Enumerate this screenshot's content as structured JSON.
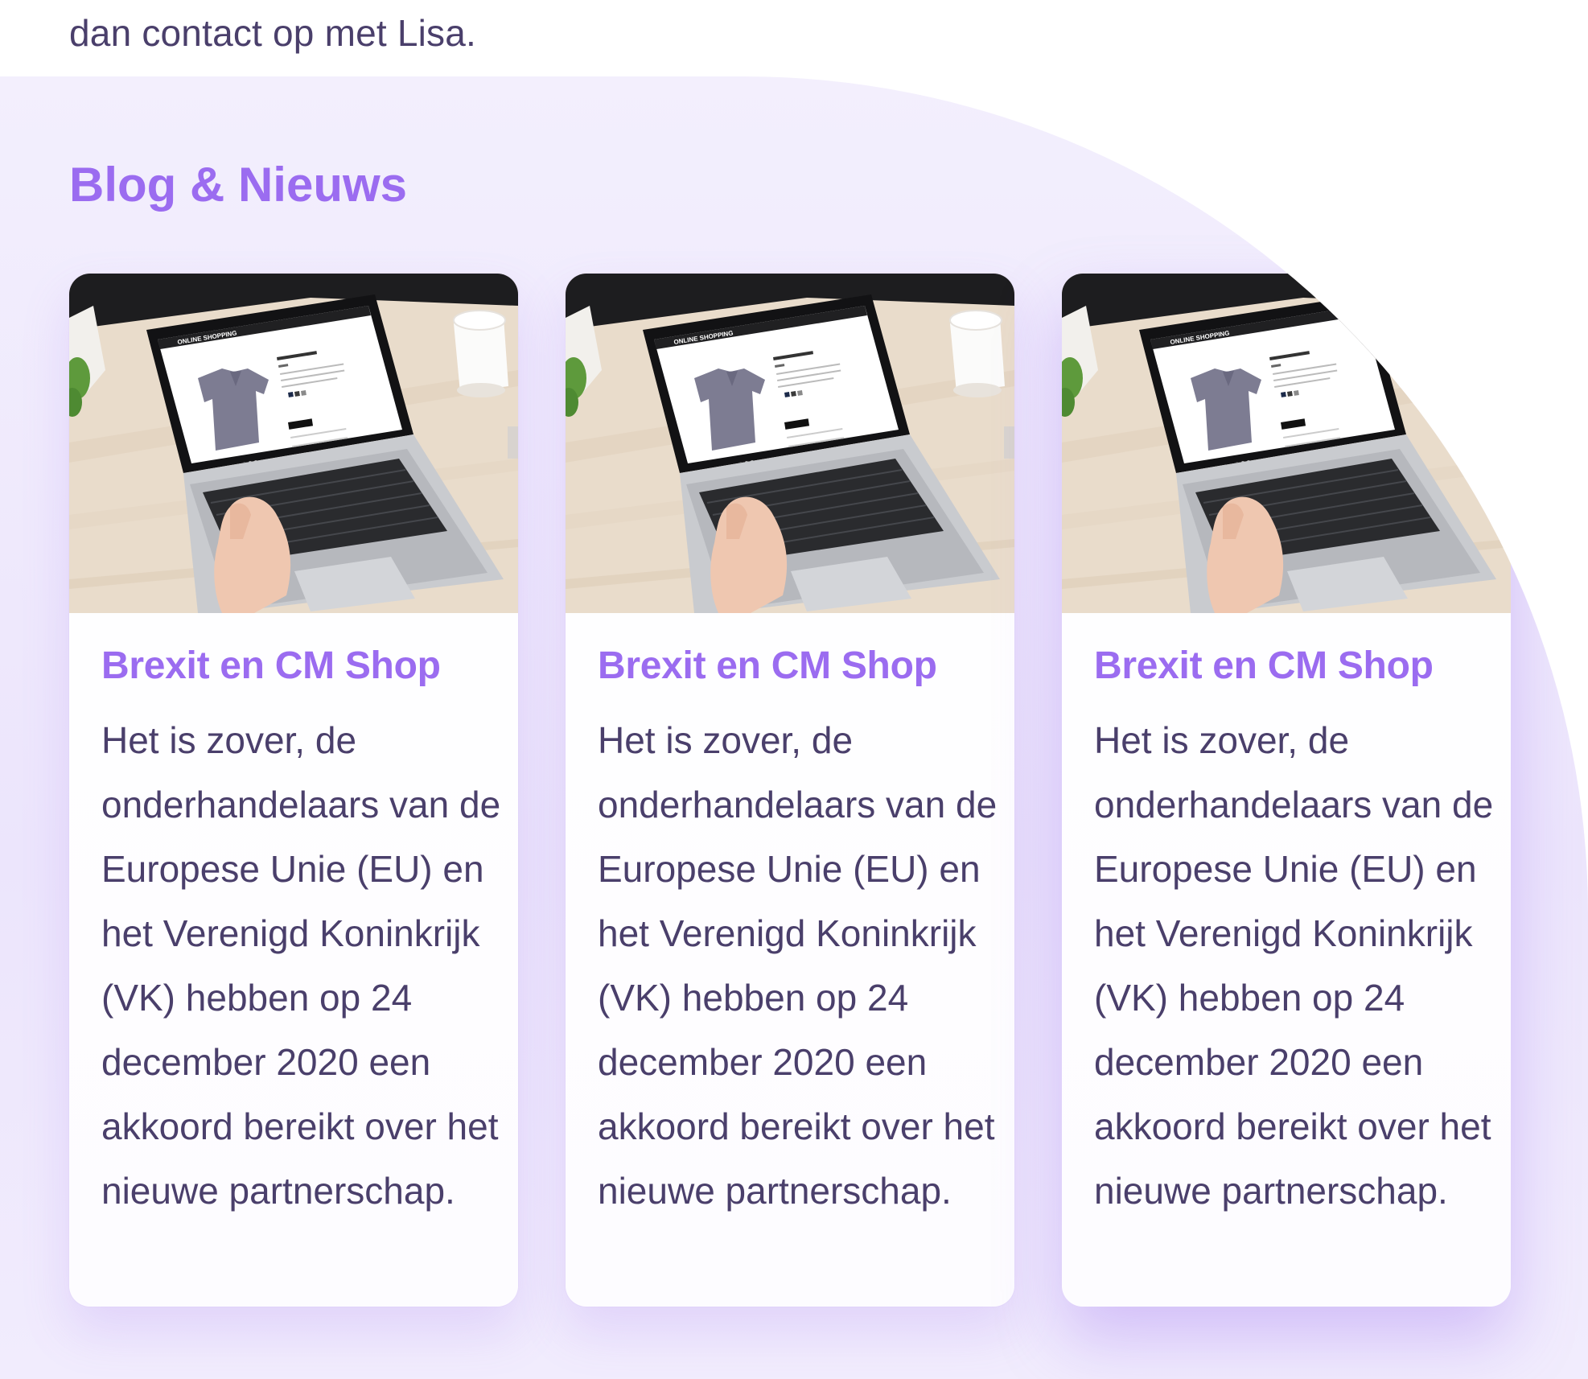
{
  "intro": {
    "text": "dan contact op met Lisa."
  },
  "blog": {
    "title": "Blog & Nieuws",
    "posts": [
      {
        "title": "Brexit en CM Shop",
        "excerpt": "Het is zover, de onderhandelaars van de Europese Unie (EU) en het Verenigd Koninkrijk (VK) hebben op 24 december 2020 een akkoord bereikt over het nieuwe partnerschap.",
        "image": "laptop-online-shopping-photo"
      },
      {
        "title": "Brexit en CM Shop",
        "excerpt": "Het is zover, de onderhandelaars van de Europese Unie (EU) en het Verenigd Koninkrijk (VK) hebben op 24 december 2020 een akkoord bereikt over het nieuwe partnerschap.",
        "image": "laptop-online-shopping-photo"
      },
      {
        "title": "Brexit en CM Shop",
        "excerpt": "Het is zover, de onderhandelaars van de Europese Unie (EU) en het Verenigd Koninkrijk (VK) hebben op 24 december 2020 een akkoord bereikt over het nieuwe partnerschap.",
        "image": "laptop-online-shopping-photo"
      }
    ],
    "screen": {
      "shop_name": "ONLINE SHOPPING",
      "product_title": "KNIT CASUAL SHIRT",
      "price": "$39",
      "cart_button": "ADD TO CART"
    }
  },
  "colors": {
    "accent": "#9b6cf0",
    "text": "#4a3f6b",
    "section_bg": "#efe9fd",
    "card_bg": "#ffffff"
  }
}
